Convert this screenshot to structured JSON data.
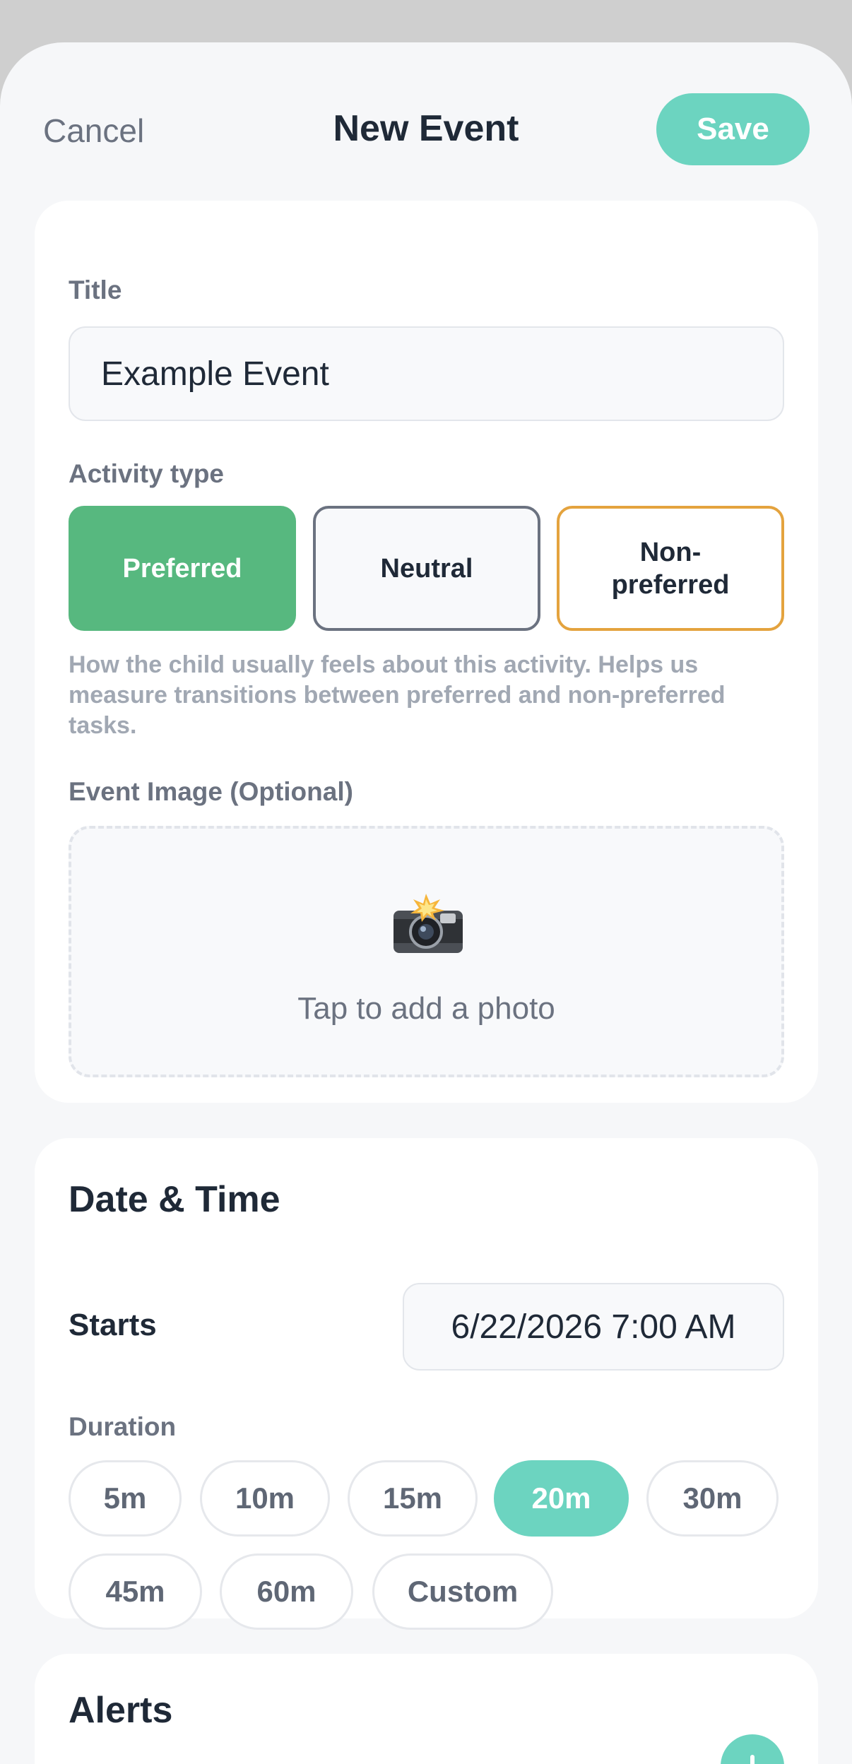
{
  "header": {
    "cancel_label": "Cancel",
    "title": "New Event",
    "save_label": "Save"
  },
  "details": {
    "title_label": "Title",
    "title_value": "Example Event",
    "activity_label": "Activity type",
    "activity_options": {
      "preferred": "Preferred",
      "neutral": "Neutral",
      "non_preferred": "Non-preferred"
    },
    "activity_selected": "Preferred",
    "helper_text": "How the child usually feels about this activity. Helps us measure transitions between preferred and non-preferred tasks.",
    "image_label": "Event Image (Optional)",
    "image_icon": "camera-with-flash-icon",
    "image_prompt": "Tap to add a photo"
  },
  "datetime": {
    "section_title": "Date & Time",
    "starts_label": "Starts",
    "starts_value": "6/22/2026 7:00 AM",
    "duration_label": "Duration",
    "durations": [
      "5m",
      "10m",
      "15m",
      "20m",
      "30m",
      "45m",
      "60m",
      "Custom"
    ],
    "duration_selected": "20m"
  },
  "alerts": {
    "section_title": "Alerts",
    "add_icon": "plus-icon"
  },
  "colors": {
    "accent": "#6cd4c0",
    "preferred": "#57b87f",
    "neutral_border": "#6b7280",
    "non_preferred_border": "#e4a33e"
  }
}
